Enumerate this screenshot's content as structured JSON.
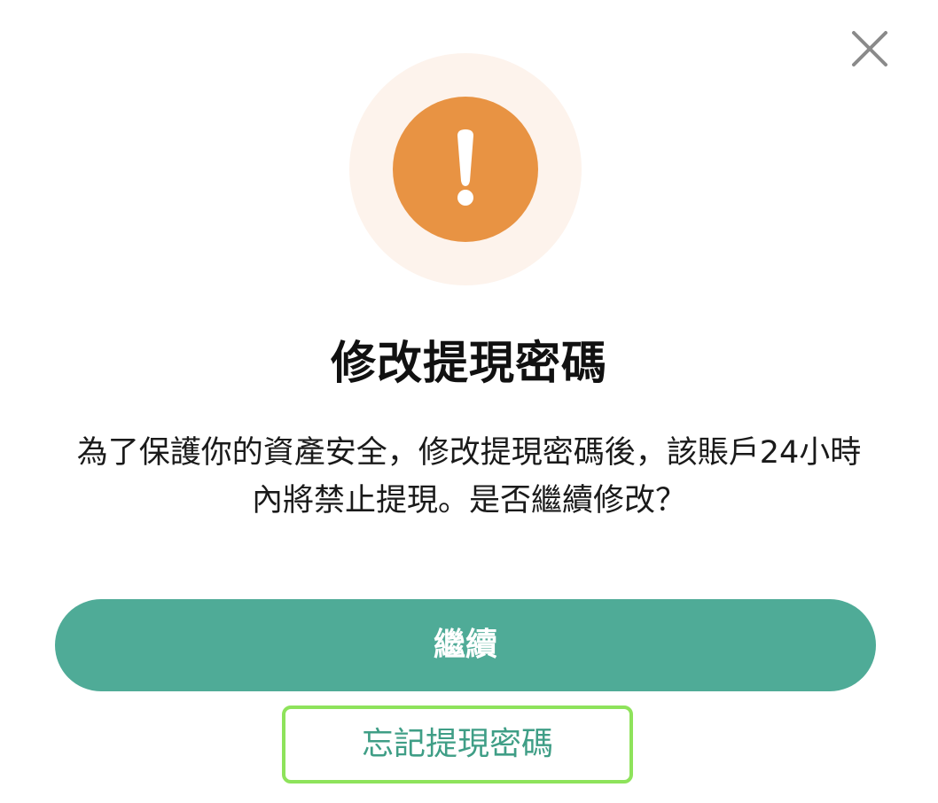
{
  "dialog": {
    "title": "修改提現密碼",
    "message_line1": "為了保護你的資產安全，修改提現密碼後，該賬戶24小時",
    "message_line2": "內將禁止提現。是否繼續修改？",
    "continue_label": "繼續",
    "forgot_label": "忘記提現密碼",
    "icons": {
      "close": "close-icon",
      "warning": "exclamation-icon"
    }
  },
  "colors": {
    "accent_green": "#4fab97",
    "warning_orange": "#e89343",
    "halo": "#fdf3ec",
    "focus_outline": "#8ee35b"
  }
}
